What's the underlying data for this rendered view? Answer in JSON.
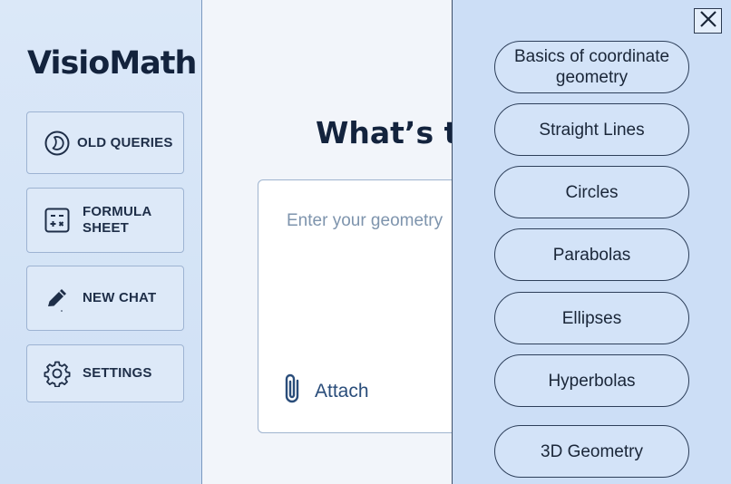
{
  "app": {
    "name": "VisioMath"
  },
  "sidebar": {
    "items": [
      {
        "label": "OLD QUERIES",
        "icon": "history-icon"
      },
      {
        "label_line1": "FORMULA",
        "label_line2": "SHEET",
        "icon": "calculator-icon"
      },
      {
        "label": "NEW CHAT",
        "icon": "pencil-icon"
      },
      {
        "label": "SETTINGS",
        "icon": "gear-icon"
      }
    ]
  },
  "main": {
    "headline": "What’s the",
    "input": {
      "placeholder": "Enter your geometry"
    },
    "attach_label": "Attach"
  },
  "topics_panel": {
    "close_icon": "close-icon",
    "topics": [
      {
        "line1": "Basics of coordinate",
        "line2": "geometry"
      },
      {
        "line1": "Straight Lines"
      },
      {
        "line1": "Circles"
      },
      {
        "line1": "Parabolas"
      },
      {
        "line1": "Ellipses"
      },
      {
        "line1": "Hyperbolas"
      },
      {
        "line1": "3D Geometry"
      }
    ]
  },
  "colors": {
    "sidebar_bg": "#d6e5f7",
    "drawer_bg": "#ccdef6",
    "text_dark": "#13233d",
    "accent": "#2a4d7a"
  }
}
